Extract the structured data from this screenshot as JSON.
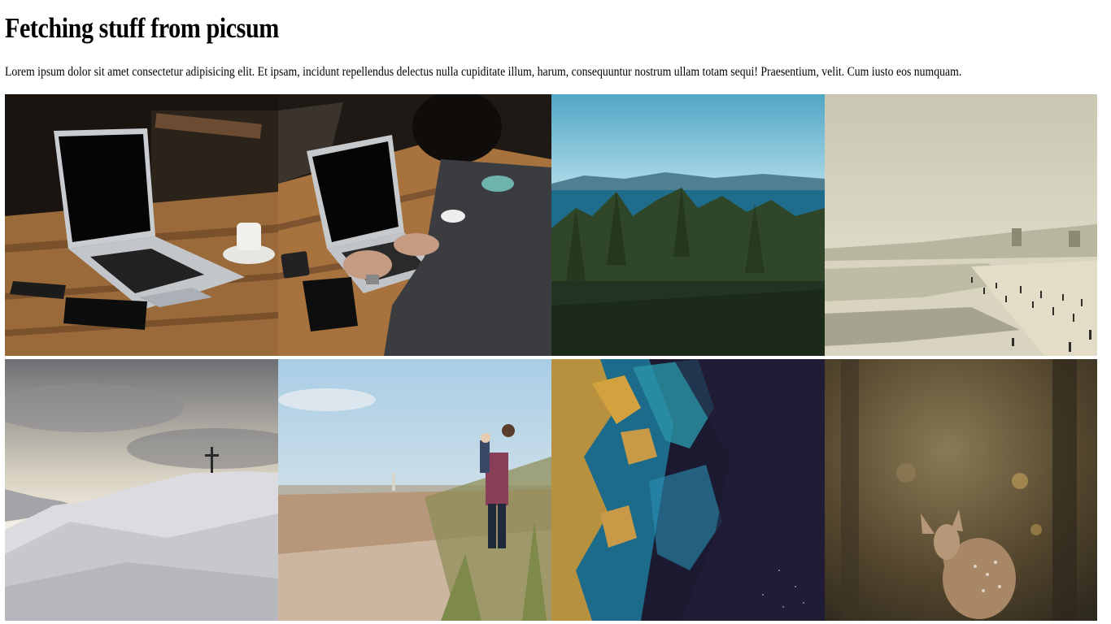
{
  "page": {
    "title": "Fetching stuff from picsum",
    "intro": "Lorem ipsum dolor sit amet consectetur adipisicing elit. Et ipsam, incidunt repellendus delectus nulla cupiditate illum, harum, consequuntur nostrum ullam totam sequi! Praesentium, velit. Cum iusto eos numquam."
  },
  "gallery": {
    "images": [
      {
        "subject": "laptop on wooden table with phone, notebook and coffee cup"
      },
      {
        "subject": "man typing on laptop at wooden table"
      },
      {
        "subject": "pine forest overlooking sea and distant mountains"
      },
      {
        "subject": "hazy beach with people in the surf and city skyline"
      },
      {
        "subject": "snowy mountain summit with cross under cloudy sky"
      },
      {
        "subject": "man carrying child on beach with dune grass"
      },
      {
        "subject": "aerial satellite view of turquoise water and golden land"
      },
      {
        "subject": "young deer in forest with bokeh background"
      }
    ]
  }
}
